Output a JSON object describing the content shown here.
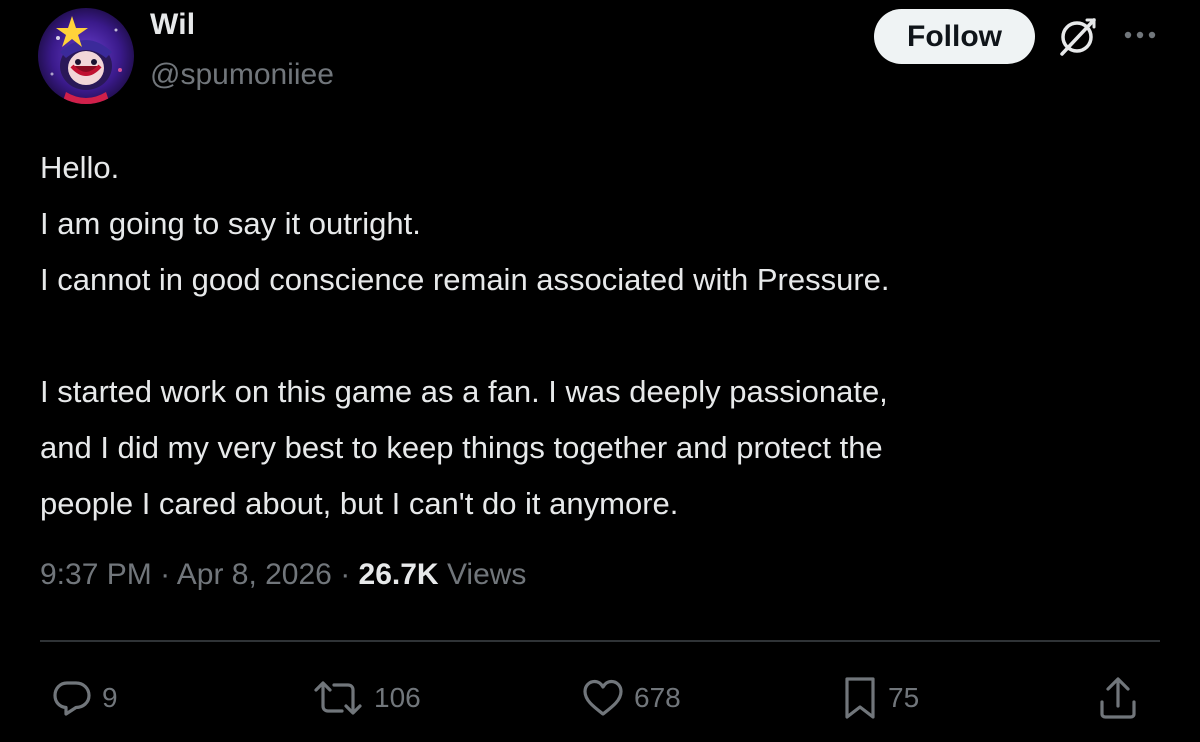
{
  "author": {
    "name": "Wil",
    "handle": "@spumoniiee"
  },
  "header": {
    "follow_label": "Follow",
    "icons": [
      "grok-icon",
      "more-icon"
    ]
  },
  "tweet": {
    "lines": [
      "Hello.",
      "I am going to say it outright.",
      "I cannot in good conscience remain associated with Pressure.",
      "",
      "I started work on this game as a fan. I was deeply passionate,",
      "and I did my very best to keep things together and protect the",
      "people I cared about, but I can't do it anymore."
    ]
  },
  "meta": {
    "time": "9:37 PM",
    "separator": " · ",
    "date": "Apr 8, 2026",
    "views_count": "26.7K",
    "views_label": " Views"
  },
  "actions": {
    "replies": "9",
    "reposts": "106",
    "likes": "678",
    "bookmarks": "75"
  },
  "colors": {
    "background": "#000000",
    "text_primary": "#e7e9ea",
    "text_secondary": "#71767b",
    "divider": "#2f3336",
    "follow_bg": "#eff3f4"
  }
}
